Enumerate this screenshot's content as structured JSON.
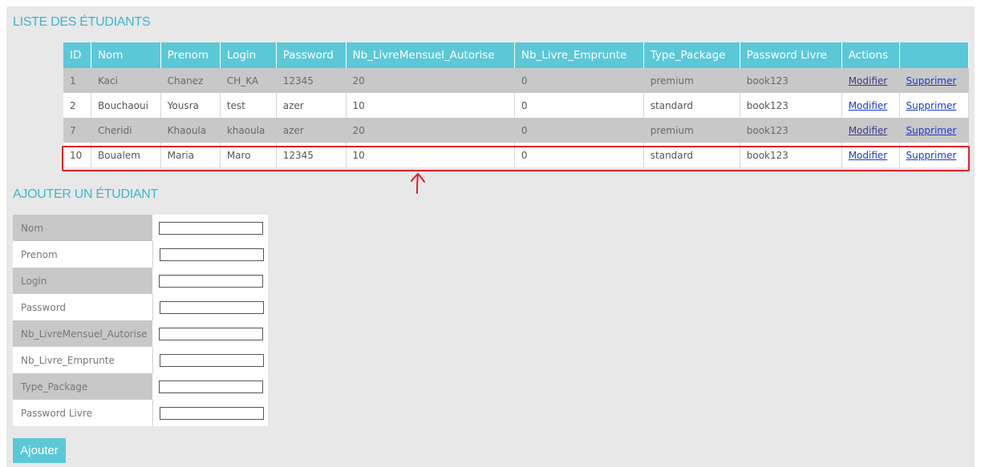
{
  "list_title": "LISTE DES ÉTUDIANTS",
  "add_title": "AJOUTER UN ÉTUDIANT",
  "table": {
    "headers": [
      "ID",
      "Nom",
      "Prenom",
      "Login",
      "Password",
      "Nb_LivreMensuel_Autorise",
      "Nb_Livre_Emprunte",
      "Type_Package",
      "Password Livre",
      "Actions",
      ""
    ],
    "rows": [
      {
        "id": "1",
        "nom": "Kaci",
        "prenom": "Chanez",
        "login": "CH_KA",
        "password": "12345",
        "nb_autorise": "20",
        "nb_emprunte": "0",
        "type_package": "premium",
        "password_livre": "book123",
        "modifier": "Modifier",
        "supprimer": "Supprimer"
      },
      {
        "id": "2",
        "nom": "Bouchaoui",
        "prenom": "Yousra",
        "login": "test",
        "password": "azer",
        "nb_autorise": "10",
        "nb_emprunte": "0",
        "type_package": "standard",
        "password_livre": "book123",
        "modifier": "Modifier",
        "supprimer": "Supprimer"
      },
      {
        "id": "7",
        "nom": "Cheridi",
        "prenom": "Khaoula",
        "login": "khaoula",
        "password": "azer",
        "nb_autorise": "20",
        "nb_emprunte": "0",
        "type_package": "premium",
        "password_livre": "book123",
        "modifier": "Modifier",
        "supprimer": "Supprimer"
      },
      {
        "id": "10",
        "nom": "Boualem",
        "prenom": "Maria",
        "login": "Maro",
        "password": "12345",
        "nb_autorise": "10",
        "nb_emprunte": "0",
        "type_package": "standard",
        "password_livre": "book123",
        "modifier": "Modifier",
        "supprimer": "Supprimer"
      }
    ]
  },
  "form": {
    "fields": [
      {
        "label": "Nom",
        "value": ""
      },
      {
        "label": "Prenom",
        "value": ""
      },
      {
        "label": "Login",
        "value": ""
      },
      {
        "label": "Password",
        "value": ""
      },
      {
        "label": "Nb_LivreMensuel_Autorise",
        "value": ""
      },
      {
        "label": "Nb_Livre_Emprunte",
        "value": ""
      },
      {
        "label": "Type_Package",
        "value": ""
      },
      {
        "label": "Password Livre",
        "value": ""
      }
    ],
    "submit_label": "Ajouter"
  },
  "colors": {
    "accent": "#5bc8d8",
    "title": "#3bb7cc",
    "highlight": "#e0202a",
    "link": "#1a3bcc"
  },
  "icons": {
    "annotation_arrow": "red-hand-drawn-up-arrow-icon"
  }
}
